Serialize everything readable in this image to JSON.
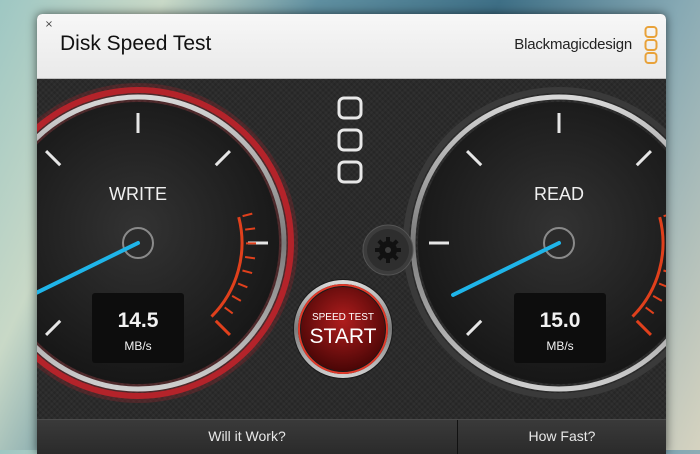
{
  "window": {
    "close_glyph": "×"
  },
  "header": {
    "title": "Disk Speed Test",
    "brand": "Blackmagicdesign"
  },
  "write": {
    "label": "WRITE",
    "value": "14.5",
    "unit": "MB/s",
    "needle_fraction": 0.07
  },
  "read": {
    "label": "READ",
    "value": "15.0",
    "unit": "MB/s",
    "needle_fraction": 0.07
  },
  "start_button": {
    "top_label": "SPEED TEST",
    "main_label": "START"
  },
  "settings": {
    "icon": "gear-icon"
  },
  "bottom": {
    "will_it_work": "Will it Work?",
    "how_fast": "How Fast?"
  },
  "colors": {
    "write_ring": "#b4232a",
    "needle": "#1fb5e9",
    "redzone": "#e0401c",
    "start_button": "#8c1212"
  }
}
